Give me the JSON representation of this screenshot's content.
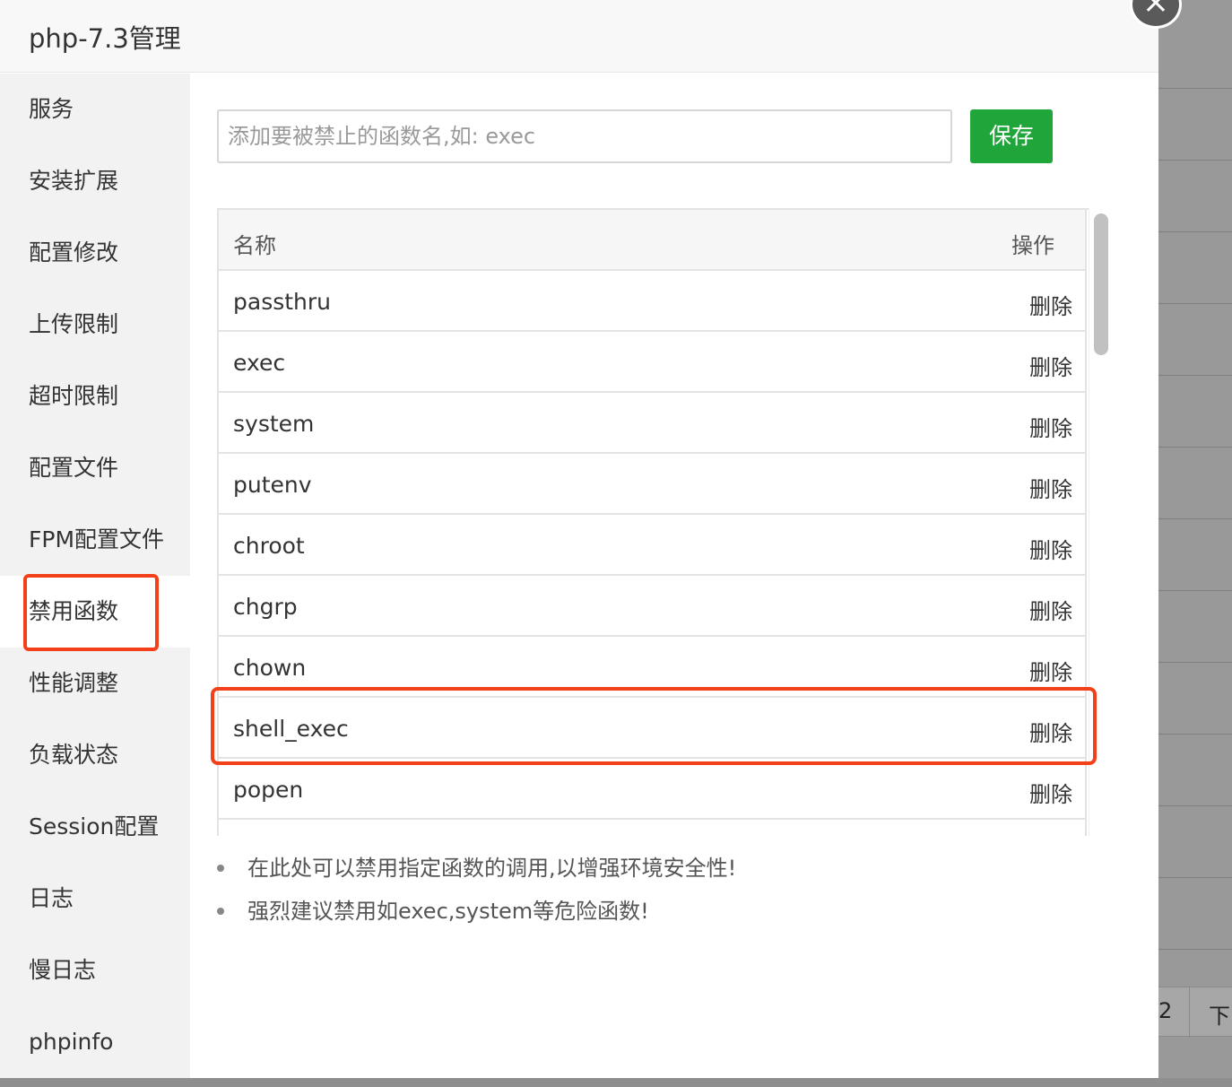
{
  "window": {
    "title": "php-7.3管理",
    "close_label": "×"
  },
  "sidebar": {
    "items": [
      {
        "label": "服务"
      },
      {
        "label": "安装扩展"
      },
      {
        "label": "配置修改"
      },
      {
        "label": "上传限制"
      },
      {
        "label": "超时限制"
      },
      {
        "label": "配置文件"
      },
      {
        "label": "FPM配置文件"
      },
      {
        "label": "禁用函数",
        "active": true
      },
      {
        "label": "性能调整"
      },
      {
        "label": "负载状态"
      },
      {
        "label": "Session配置"
      },
      {
        "label": "日志"
      },
      {
        "label": "慢日志"
      },
      {
        "label": "phpinfo"
      }
    ]
  },
  "form": {
    "placeholder": "添加要被禁止的函数名,如: exec",
    "save_label": "保存"
  },
  "table": {
    "headers": {
      "name": "名称",
      "operation": "操作"
    },
    "rows": [
      {
        "name": "passthru",
        "action": "删除"
      },
      {
        "name": "exec",
        "action": "删除"
      },
      {
        "name": "system",
        "action": "删除"
      },
      {
        "name": "putenv",
        "action": "删除"
      },
      {
        "name": "chroot",
        "action": "删除"
      },
      {
        "name": "chgrp",
        "action": "删除"
      },
      {
        "name": "chown",
        "action": "删除"
      },
      {
        "name": "shell_exec",
        "action": "删除"
      },
      {
        "name": "popen",
        "action": "删除"
      }
    ]
  },
  "tips": [
    "在此处可以禁用指定函数的调用,以增强环境安全性!",
    "强烈建议禁用如exec,system等危险函数!"
  ],
  "background": {
    "pager_page": "2",
    "pager_next": "下"
  },
  "colors": {
    "accent_green": "#20a53a",
    "highlight_red": "#f3401b"
  }
}
